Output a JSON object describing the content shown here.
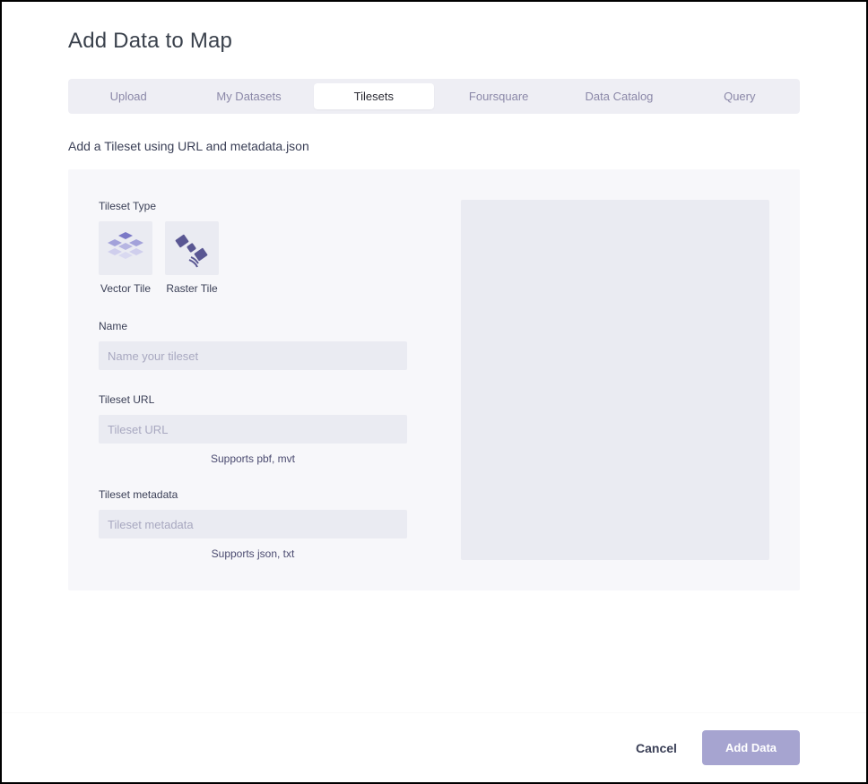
{
  "title": "Add Data to Map",
  "tabs": {
    "items": [
      {
        "label": "Upload"
      },
      {
        "label": "My Datasets"
      },
      {
        "label": "Tilesets"
      },
      {
        "label": "Foursquare"
      },
      {
        "label": "Data Catalog"
      },
      {
        "label": "Query"
      }
    ]
  },
  "subtitle": "Add a Tileset using URL and metadata.json",
  "form": {
    "tileset_type_label": "Tileset Type",
    "tile_types": {
      "vector": "Vector Tile",
      "raster": "Raster Tile"
    },
    "name_label": "Name",
    "name_placeholder": "Name your tileset",
    "url_label": "Tileset URL",
    "url_placeholder": "Tileset URL",
    "url_hint": "Supports pbf, mvt",
    "metadata_label": "Tileset metadata",
    "metadata_placeholder": "Tileset metadata",
    "metadata_hint": "Supports json, txt"
  },
  "footer": {
    "cancel": "Cancel",
    "submit": "Add Data"
  }
}
